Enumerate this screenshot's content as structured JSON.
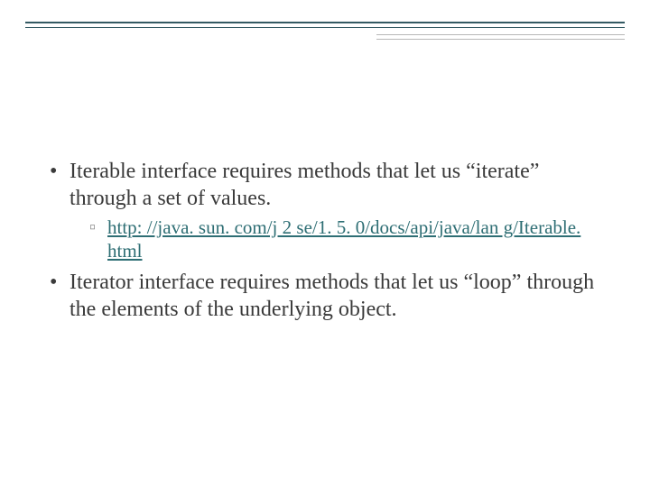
{
  "content": {
    "bullet1": "Iterable interface requires methods that let us “iterate” through a set of values.",
    "subbullet1_link": "http: //java. sun. com/j 2 se/1. 5. 0/docs/api/java/lan g/Iterable. html",
    "bullet2": " Iterator interface requires methods that let us “loop” through the elements of the underlying object."
  },
  "colors": {
    "rule_dark": "#345a63",
    "rule_light": "#b7b7b7",
    "link": "#2e6e74",
    "text": "#3a3a3a"
  }
}
